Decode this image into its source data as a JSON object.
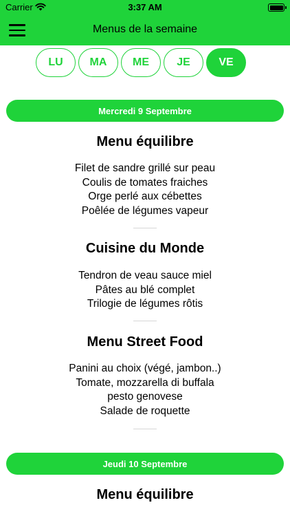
{
  "status_bar": {
    "carrier": "Carrier",
    "time": "3:37 AM"
  },
  "nav": {
    "title": "Menus de la semaine"
  },
  "days": [
    {
      "label": "LU",
      "active": false
    },
    {
      "label": "MA",
      "active": false
    },
    {
      "label": "ME",
      "active": false
    },
    {
      "label": "JE",
      "active": false
    },
    {
      "label": "VE",
      "active": true
    }
  ],
  "sections": [
    {
      "date": "Mercredi 9 Septembre",
      "menus": [
        {
          "title": "Menu équilibre",
          "items": [
            "Filet de sandre grillé sur peau",
            "Coulis de tomates fraiches",
            "Orge perlé aux cébettes",
            "Poêlée de légumes vapeur"
          ]
        },
        {
          "title": "Cuisine du Monde",
          "items": [
            "Tendron de veau sauce miel",
            "Pâtes au blé complet",
            "Trilogie de légumes rôtis"
          ]
        },
        {
          "title": "Menu Street Food",
          "items": [
            "Panini au choix (végé, jambon..)",
            "Tomate, mozzarella di buffala",
            "pesto genovese",
            "Salade de roquette"
          ]
        }
      ]
    },
    {
      "date": "Jeudi 10 Septembre",
      "menus": [
        {
          "title": "Menu équilibre",
          "items": []
        }
      ]
    }
  ],
  "colors": {
    "accent": "#1fd33a",
    "separator": "#d6d6d6"
  },
  "icons": {
    "menu": "hamburger-menu-icon",
    "wifi": "wifi-icon",
    "battery": "battery-icon"
  }
}
